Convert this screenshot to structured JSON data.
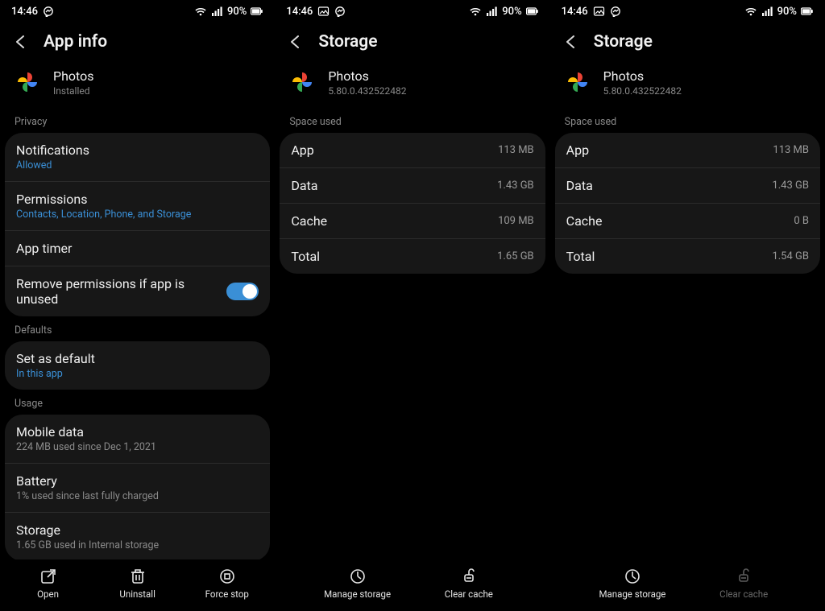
{
  "status": {
    "time": "14:46",
    "battery": "90%"
  },
  "screen1": {
    "title": "App info",
    "app": {
      "name": "Photos",
      "sub": "Installed"
    },
    "privacy_label": "Privacy",
    "notifications": {
      "title": "Notifications",
      "sub": "Allowed"
    },
    "permissions": {
      "title": "Permissions",
      "sub": "Contacts, Location, Phone, and Storage"
    },
    "apptimer": {
      "title": "App timer"
    },
    "remove_perm": {
      "title": "Remove permissions if app is unused"
    },
    "defaults_label": "Defaults",
    "setdefault": {
      "title": "Set as default",
      "sub": "In this app"
    },
    "usage_label": "Usage",
    "mobiledata": {
      "title": "Mobile data",
      "sub": "224 MB used since Dec 1, 2021"
    },
    "battery": {
      "title": "Battery",
      "sub": "1% used since last fully charged"
    },
    "storage": {
      "title": "Storage",
      "sub": "1.65 GB used in Internal storage"
    },
    "bottom": {
      "open": "Open",
      "uninstall": "Uninstall",
      "forcestop": "Force stop"
    }
  },
  "screen2": {
    "title": "Storage",
    "app": {
      "name": "Photos",
      "sub": "5.80.0.432522482"
    },
    "space_label": "Space used",
    "rows": {
      "app": {
        "t": "App",
        "v": "113 MB"
      },
      "data": {
        "t": "Data",
        "v": "1.43 GB"
      },
      "cache": {
        "t": "Cache",
        "v": "109 MB"
      },
      "total": {
        "t": "Total",
        "v": "1.65 GB"
      }
    },
    "bottom": {
      "manage": "Manage storage",
      "clear": "Clear cache"
    }
  },
  "screen3": {
    "title": "Storage",
    "app": {
      "name": "Photos",
      "sub": "5.80.0.432522482"
    },
    "space_label": "Space used",
    "rows": {
      "app": {
        "t": "App",
        "v": "113 MB"
      },
      "data": {
        "t": "Data",
        "v": "1.43 GB"
      },
      "cache": {
        "t": "Cache",
        "v": "0 B"
      },
      "total": {
        "t": "Total",
        "v": "1.54 GB"
      }
    },
    "bottom": {
      "manage": "Manage storage",
      "clear": "Clear cache"
    }
  }
}
